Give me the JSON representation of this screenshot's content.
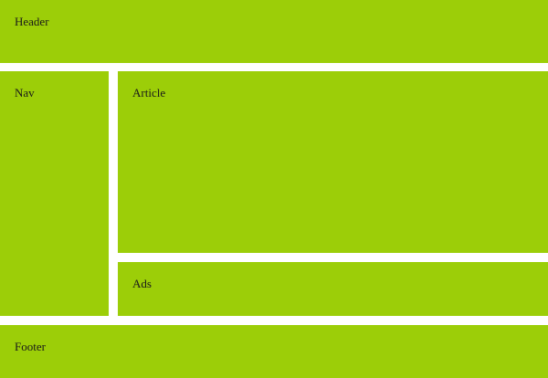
{
  "colors": {
    "block_fill": "#9cce08",
    "background": "#ffffff",
    "text": "#1a1a1a"
  },
  "blocks": {
    "header": {
      "label": "Header"
    },
    "nav": {
      "label": "Nav"
    },
    "article": {
      "label": "Article"
    },
    "ads": {
      "label": "Ads"
    },
    "footer": {
      "label": "Footer"
    }
  }
}
